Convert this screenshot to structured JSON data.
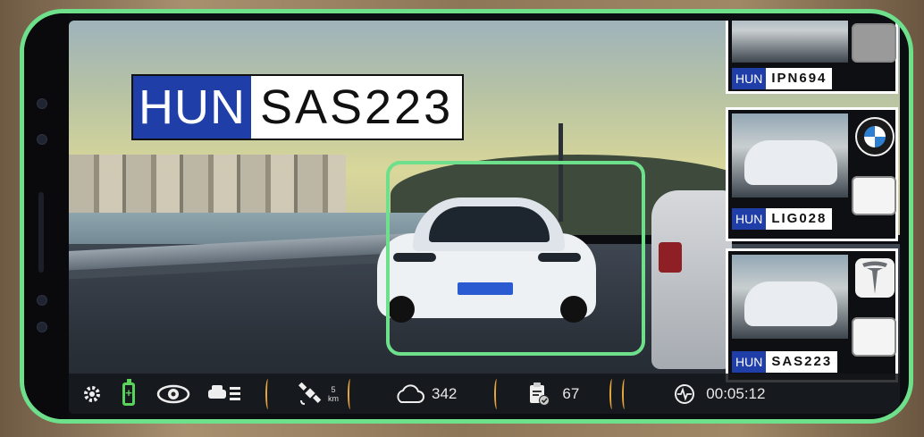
{
  "main_plate": {
    "country": "HUN",
    "number": "SAS223"
  },
  "cards": [
    {
      "country": "HUN",
      "plate": "IPN694",
      "logo": "none"
    },
    {
      "country": "HUN",
      "plate": "LIG028",
      "logo": "bmw-logo"
    },
    {
      "country": "HUN",
      "plate": "SAS223",
      "logo": "tesla-logo"
    }
  ],
  "hud": {
    "distance_value": "5",
    "distance_unit": "km",
    "cloud_count": "342",
    "report_count": "67",
    "timer": "00:05:12"
  },
  "colors": {
    "accent": "#6ee08c",
    "separator": "#e6a63a",
    "plate_blue": "#1f3ea8",
    "battery": "#59d35a"
  }
}
